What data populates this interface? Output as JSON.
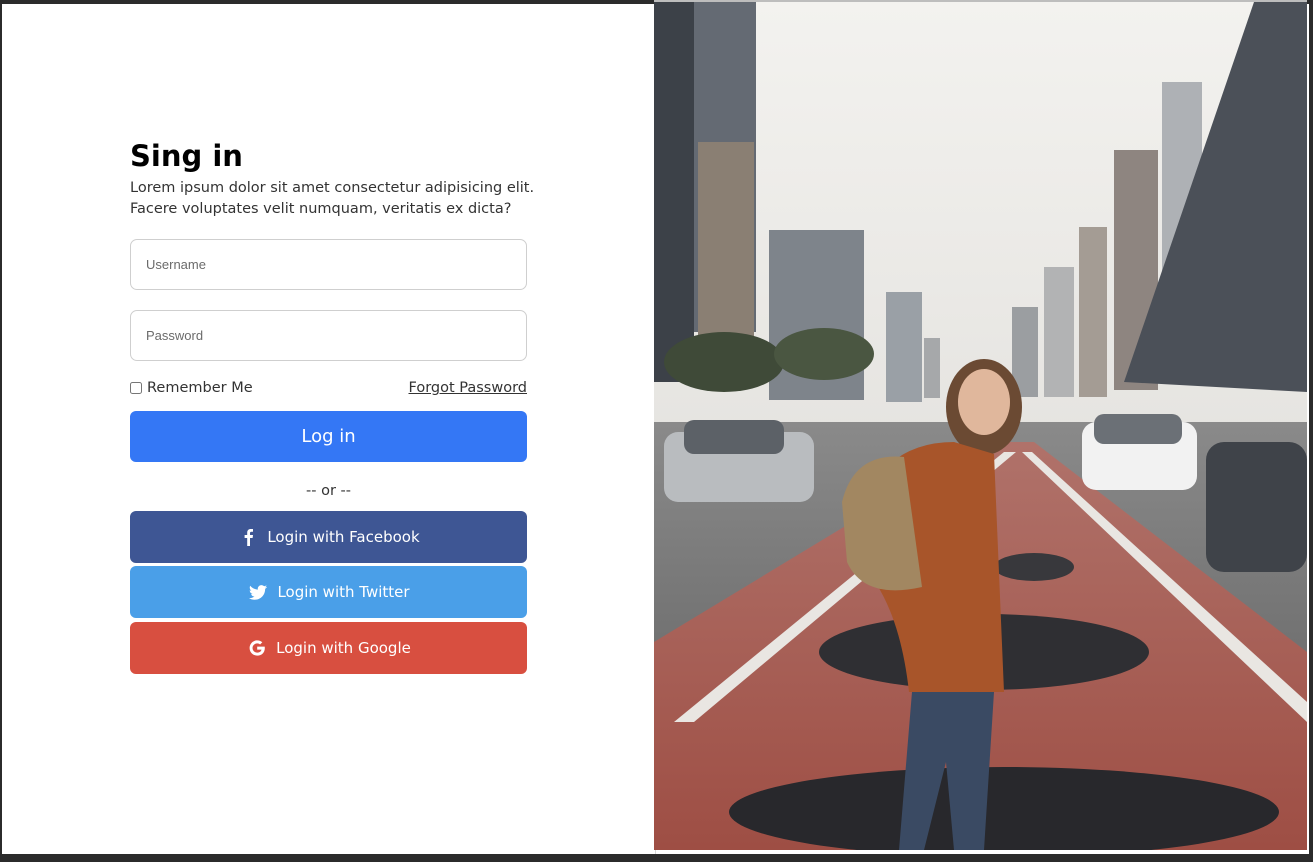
{
  "form": {
    "title": "Sing in",
    "description_line1": "Lorem ipsum dolor sit amet consectetur adipisicing elit.",
    "description_line2": "Facere voluptates velit numquam, veritatis ex dicta?",
    "username_placeholder": "Username",
    "password_placeholder": "Password",
    "remember_label": "Remember Me",
    "remember_checked": false,
    "forgot_label": "Forgot Password",
    "login_label": "Log in",
    "or_label": "-- or --"
  },
  "social": {
    "facebook_label": "Login with Facebook",
    "twitter_label": "Login with Twitter",
    "google_label": "Login with Google"
  },
  "colors": {
    "login": "#3477f5",
    "facebook": "#3e5694",
    "twitter": "#4a9fe8",
    "google": "#d84f40"
  },
  "hero": {
    "icon": "photo-woman-city-street"
  }
}
